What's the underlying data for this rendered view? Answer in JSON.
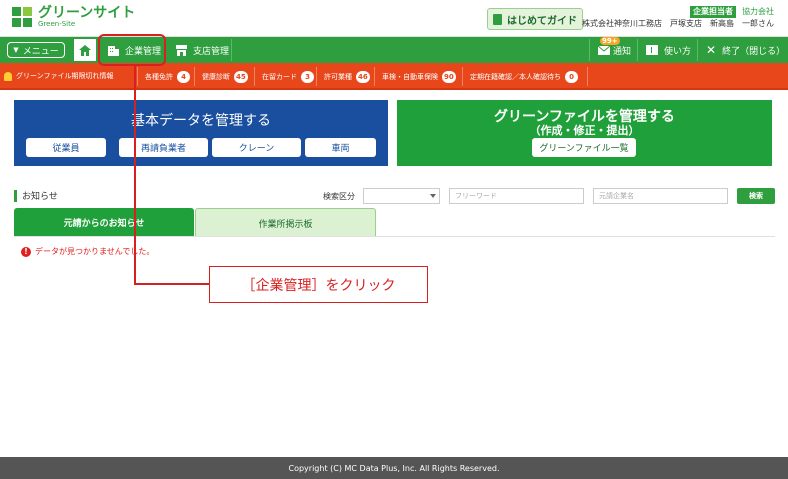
{
  "header": {
    "logo_jp": "グリーンサイト",
    "logo_en": "Green-Site",
    "guide_label": "はじめてガイド",
    "role_badge": "企業担当者",
    "role_sub": "協力会社",
    "company": "株式会社神奈川工務店　戸塚支店　新高島　一郎さん"
  },
  "nav": {
    "menu_label": "メニュー",
    "company_mgmt": "企業管理",
    "branch_mgmt": "支店管理",
    "notice_badge": "99+",
    "notice_label": "通知",
    "help_label": "使い方",
    "close_label": "終了（閉じる）"
  },
  "alerts": {
    "title": "グリーンファイル期限切れ情報",
    "items": [
      {
        "label": "各種免許",
        "count": "4"
      },
      {
        "label": "健康診断",
        "count": "45"
      },
      {
        "label": "在留カード",
        "count": "3"
      },
      {
        "label": "許可業種",
        "count": "46"
      },
      {
        "label": "車検・自動車保険",
        "count": "90"
      },
      {
        "label": "定期在籍確認／本人確認待ち",
        "count": "0"
      }
    ]
  },
  "basic": {
    "title": "基本データを管理する",
    "buttons": [
      "従業員",
      "再請負業者",
      "クレーン",
      "車両"
    ]
  },
  "green": {
    "title": "グリーンファイルを管理する",
    "subtitle": "（作成・修正・提出）",
    "button": "グリーンファイル一覧"
  },
  "notice": {
    "heading": "お知らせ",
    "search_label": "検索区分",
    "free_placeholder": "フリーワード",
    "company_placeholder": "元請企業名",
    "search_button": "検索",
    "tab_primary": "元請からのお知らせ",
    "tab_board": "作業所掲示板",
    "empty": "データが見つかりませんでした。"
  },
  "annotation": {
    "callout": "［企業管理］をクリック"
  },
  "footer": {
    "copyright": "Copyright (C) MC Data Plus, Inc. All Rights Reserved."
  },
  "colors": {
    "green": "#2e9e3e",
    "red": "#e8471c",
    "blue": "#1a4fa0"
  }
}
